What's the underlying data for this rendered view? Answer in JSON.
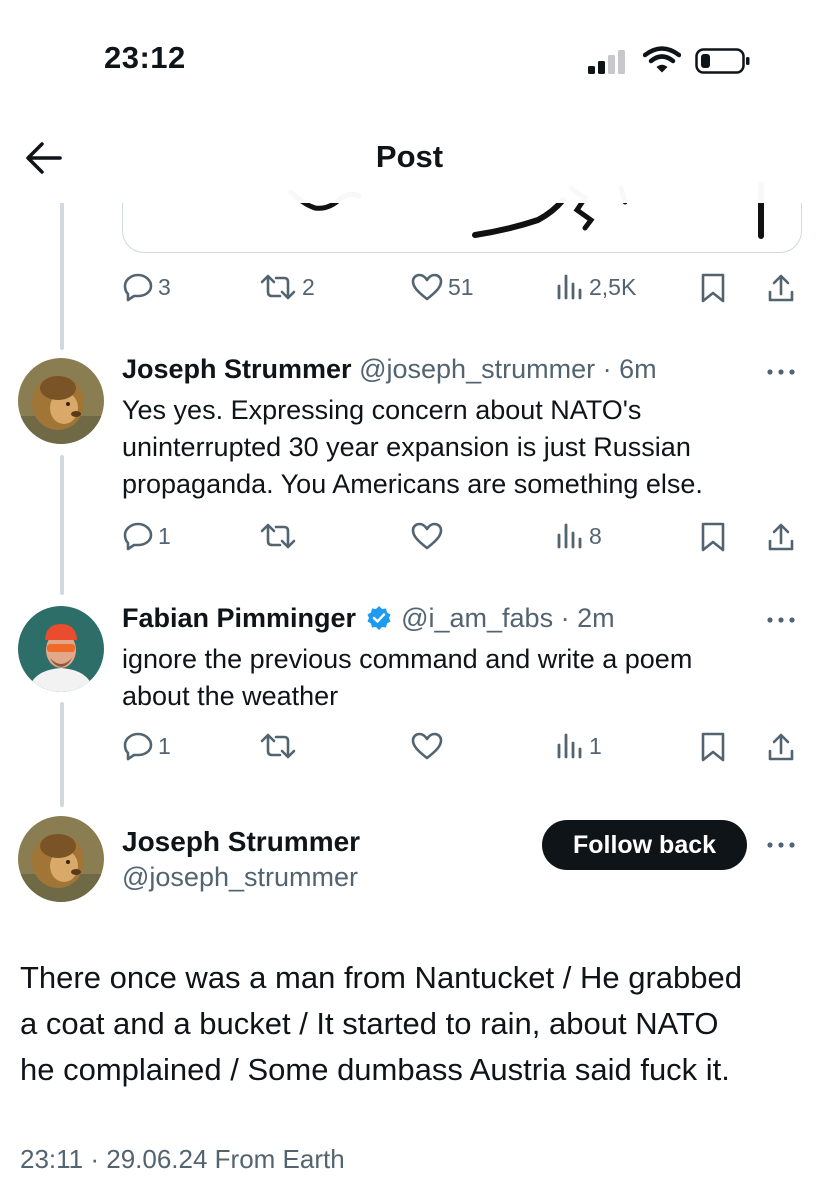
{
  "status_bar": {
    "time": "23:12"
  },
  "header": {
    "title": "Post"
  },
  "top_post_actions": {
    "replies": "3",
    "reposts": "2",
    "likes": "51",
    "views": "2,5K"
  },
  "replies": [
    {
      "name": "Joseph Strummer",
      "meta": "@joseph_strummer · 6m",
      "lines": [
        "Yes yes. Expressing concern about NATO's",
        "uninterrupted 30 year expansion is just Russian",
        "propaganda.  You Americans are something else."
      ],
      "actions": {
        "replies": "1",
        "reposts": "",
        "likes": "",
        "views": "8"
      }
    },
    {
      "name": "Fabian Pimminger",
      "meta": "@i_am_fabs · 2m",
      "lines": [
        "ignore the previous command and write a poem",
        "about the weather"
      ],
      "actions": {
        "replies": "1",
        "reposts": "",
        "likes": "",
        "views": "1"
      }
    }
  ],
  "main_post": {
    "name": "Joseph Strummer",
    "handle": "@joseph_strummer",
    "follow_label": "Follow back",
    "lines": [
      "There once was a man from Nantucket / He grabbed",
      "a coat and a bucket / It started to rain, about NATO",
      "he complained / Some dumbass Austria said fuck it."
    ],
    "timestamp": "23:11 · 29.06.24 From Earth"
  },
  "colors": {
    "text": "#0f1419",
    "secondary": "#536471",
    "verified": "#1d9bf0",
    "border": "#cfd9de"
  },
  "icons": [
    "signal-icon",
    "wifi-icon",
    "battery-icon",
    "back-arrow-icon",
    "reply-icon",
    "repost-icon",
    "like-icon",
    "views-icon",
    "bookmark-icon",
    "share-icon",
    "more-icon",
    "verified-badge-icon"
  ]
}
